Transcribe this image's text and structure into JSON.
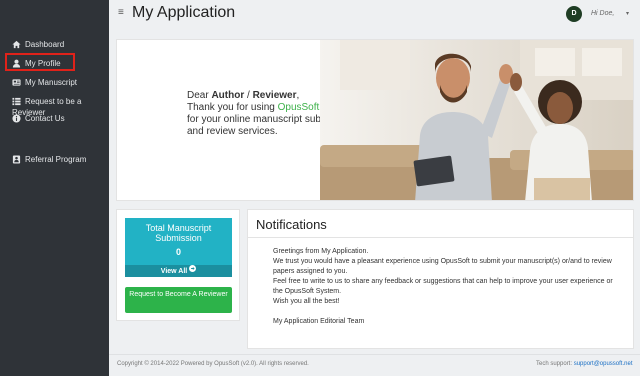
{
  "sidebar": {
    "items": [
      {
        "label": "Dashboard",
        "icon": "home-icon"
      },
      {
        "label": "My Profile",
        "icon": "user-icon"
      },
      {
        "label": "My Manuscript",
        "icon": "manuscript-icon"
      },
      {
        "label": "Request to be a Reviewer",
        "icon": "list-icon"
      },
      {
        "label": "Contact Us",
        "icon": "info-icon"
      },
      {
        "label": "Referral Program",
        "icon": "referral-icon"
      }
    ]
  },
  "header": {
    "menu_icon": "≡",
    "title": "My Application",
    "avatar_initial": "D",
    "user_greeting": "Hi Doe,",
    "caret": "▾"
  },
  "hero": {
    "line1_prefix": "Dear ",
    "role_author": "Author",
    "slash": " / ",
    "role_reviewer": "Reviewer",
    "line1_suffix": ",",
    "line2_prefix": "Thank you for using ",
    "brand": "OpusSoft",
    "line3": "for your online manuscript submission",
    "line4": "and review services."
  },
  "stats": {
    "title": "Total Manuscript Submission",
    "value": "0",
    "view_all": "View All"
  },
  "request_button": "Request to Become A Reviewer",
  "notifications": {
    "title": "Notifications",
    "paragraphs": [
      "Greetings from My Application.",
      "We trust you would have a pleasant experience using OpusSoft to submit your manuscript(s) or/and to review papers assigned to you.",
      "Feel free to write to us to share any feedback or suggestions that can help to improve your user experience or the OpusSoft System.",
      "Wish you all the best!",
      "My Application Editorial Team"
    ]
  },
  "footer": {
    "copyright": "Copyright © 2014-2022 Powered by OpusSoft (v2.0). All rights reserved.",
    "support_label": "Tech support: ",
    "support_email": "support@opussoft.net"
  },
  "colors": {
    "sidebar": "#2f3338",
    "accent_teal": "#22b2c5",
    "accent_green": "#2db34a",
    "brand_green": "#3db14a",
    "highlight_red": "#e0221a"
  }
}
